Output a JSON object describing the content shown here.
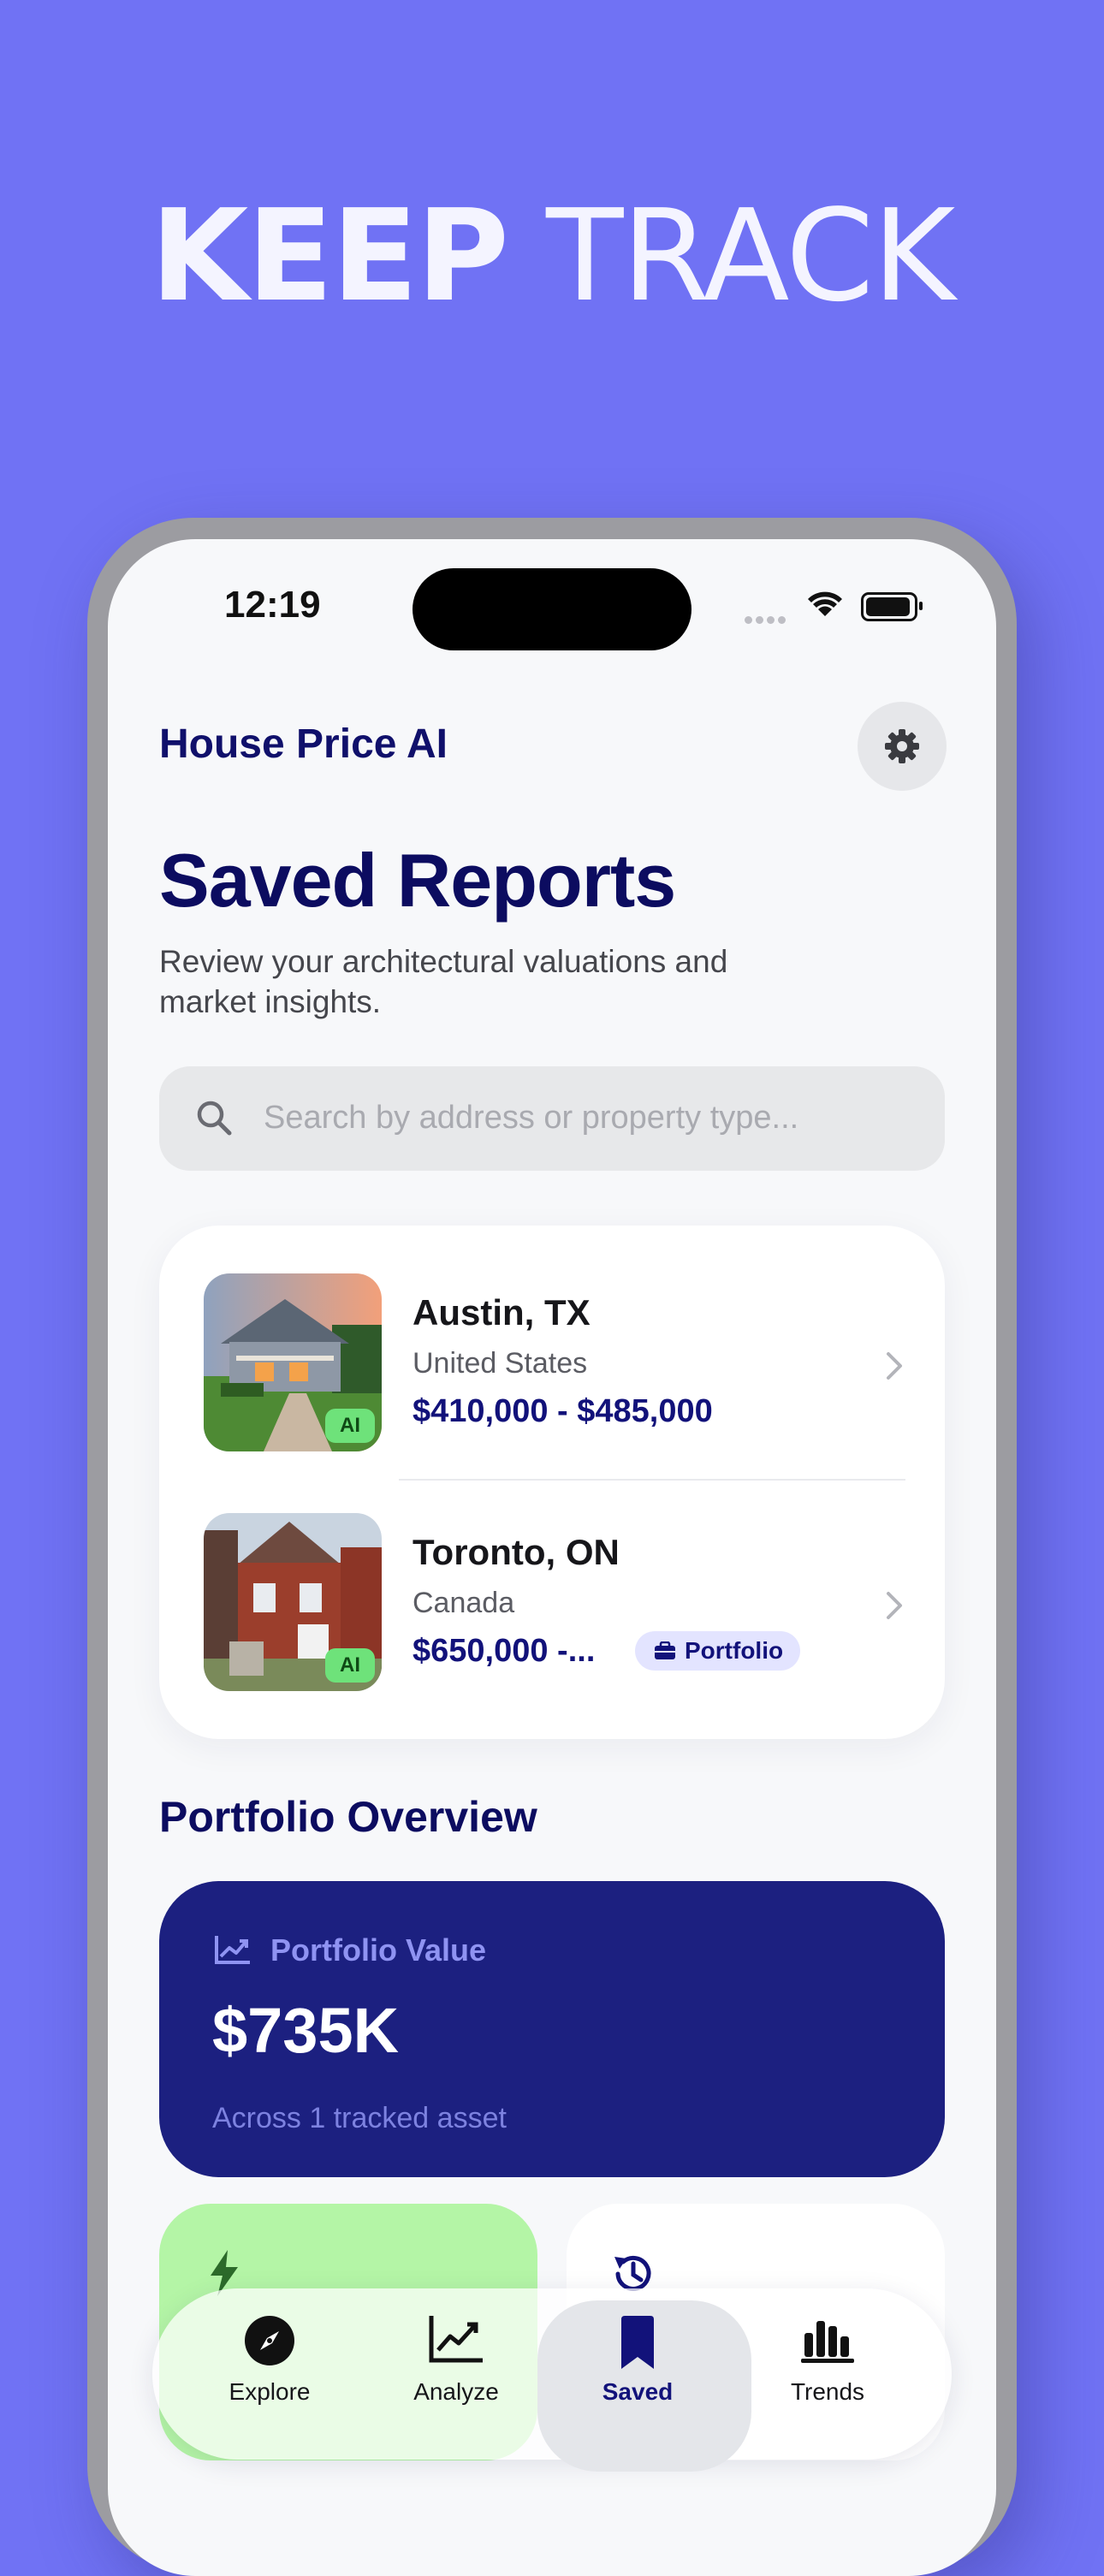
{
  "promo": {
    "headline_bold": "KEEP",
    "headline_light": "TRACK"
  },
  "status_bar": {
    "time": "12:19"
  },
  "header": {
    "brand": "House Price AI",
    "settings_icon": "gear-icon"
  },
  "page": {
    "title": "Saved Reports",
    "subtitle": "Review your architectural valuations and market insights."
  },
  "search": {
    "placeholder": "Search by address or property type..."
  },
  "reports": [
    {
      "city": "Austin, TX",
      "country": "United States",
      "price": "$410,000 - $485,000",
      "badge": "AI"
    },
    {
      "city": "Toronto, ON",
      "country": "Canada",
      "price": "$650,000 -...",
      "badge": "AI",
      "tag": "Portfolio"
    }
  ],
  "portfolio": {
    "section_title": "Portfolio Overview",
    "card_label": "Portfolio Value",
    "value": "$735K",
    "subtext": "Across 1 tracked asset"
  },
  "tabs": [
    {
      "label": "Explore",
      "icon": "compass-icon"
    },
    {
      "label": "Analyze",
      "icon": "line-chart-icon"
    },
    {
      "label": "Saved",
      "icon": "bookmark-icon",
      "active": true
    },
    {
      "label": "Trends",
      "icon": "bar-chart-icon"
    }
  ],
  "colors": {
    "background": "#7072F4",
    "primary": "#12127A",
    "card_dark": "#1C2080",
    "ai_badge": "#6EE27A"
  }
}
